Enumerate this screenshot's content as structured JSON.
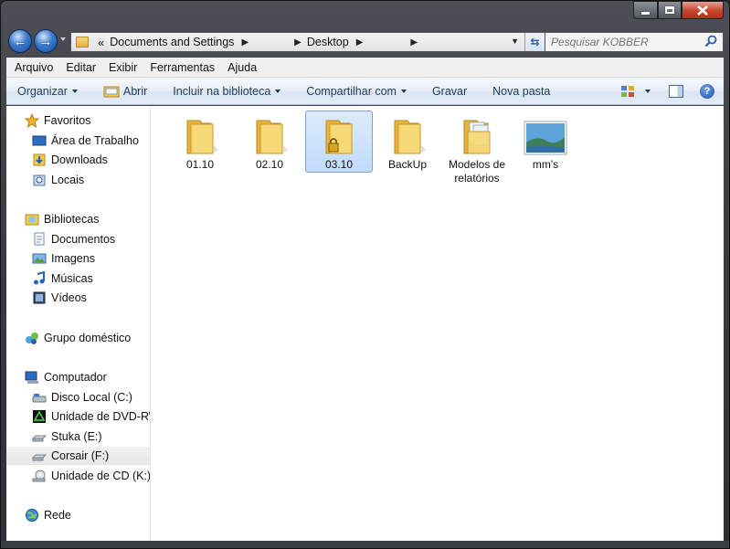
{
  "window": {
    "caption_buttons": [
      "minimize-icon",
      "maximize-icon",
      "close-icon"
    ]
  },
  "navigation": {
    "back_icon": "back-arrow-icon",
    "forward_icon": "forward-arrow-icon",
    "breadcrumb_overflow": "«",
    "breadcrumb": [
      "Documents and Settings",
      "Desktop"
    ],
    "search_placeholder": "Pesquisar KOBBER"
  },
  "menubar": {
    "items": [
      "Arquivo",
      "Editar",
      "Exibir",
      "Ferramentas",
      "Ajuda"
    ]
  },
  "commandbar": {
    "organize": "Organizar",
    "open": "Abrir",
    "include_library": "Incluir na biblioteca",
    "share": "Compartilhar com",
    "burn": "Gravar",
    "new_folder": "Nova pasta"
  },
  "navpane": {
    "favorites": {
      "header": "Favoritos",
      "items": [
        "Área de Trabalho",
        "Downloads",
        "Locais"
      ]
    },
    "libraries": {
      "header": "Bibliotecas",
      "items": [
        "Documentos",
        "Imagens",
        "Músicas",
        "Vídeos"
      ]
    },
    "homegroup": "Grupo doméstico",
    "computer": {
      "header": "Computador",
      "items": [
        "Disco Local (C:)",
        "Unidade de DVD-RW",
        "Stuka (E:)",
        "Corsair (F:)",
        "Unidade de CD (K:)"
      ],
      "selected": "Corsair (F:)"
    },
    "network": "Rede"
  },
  "files": [
    {
      "name": "01.10",
      "type": "folder"
    },
    {
      "name": "02.10",
      "type": "folder"
    },
    {
      "name": "03.10",
      "type": "folder-locked",
      "selected": true
    },
    {
      "name": "BackUp",
      "type": "folder"
    },
    {
      "name_line1": "Modelos de",
      "name_line2": "relatórios",
      "type": "folder-documents"
    },
    {
      "name": "mm's",
      "type": "image"
    }
  ],
  "colors": {
    "accent": "#1e395b",
    "selection": "#c1dbfc",
    "folder": "#f2c94c"
  }
}
